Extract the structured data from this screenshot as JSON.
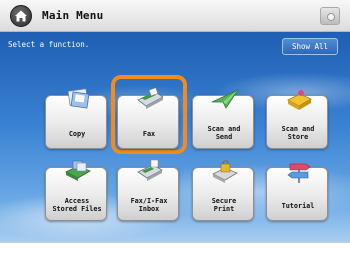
{
  "header": {
    "title": "Main Menu",
    "home_icon": "home-icon",
    "corner_icon": "status-indicator-icon"
  },
  "main": {
    "prompt": "Select a function.",
    "show_all_label": "Show All",
    "selected_tile": "Fax",
    "highlight_color": "#f28a1e",
    "tiles": [
      {
        "line1": "Copy",
        "line2": "",
        "icon": "copier-icon"
      },
      {
        "line1": "Fax",
        "line2": "",
        "icon": "fax-icon"
      },
      {
        "line1": "Scan and",
        "line2": "Send",
        "icon": "paper-plane-icon"
      },
      {
        "line1": "Scan and",
        "line2": "Store",
        "icon": "scan-store-icon"
      },
      {
        "line1": "Access",
        "line2": "Stored Files",
        "icon": "stored-files-icon"
      },
      {
        "line1": "Fax/I-Fax",
        "line2": "Inbox",
        "icon": "fax-inbox-icon"
      },
      {
        "line1": "Secure",
        "line2": "Print",
        "icon": "lock-printer-icon"
      },
      {
        "line1": "Tutorial",
        "line2": "",
        "icon": "signpost-icon"
      }
    ]
  }
}
